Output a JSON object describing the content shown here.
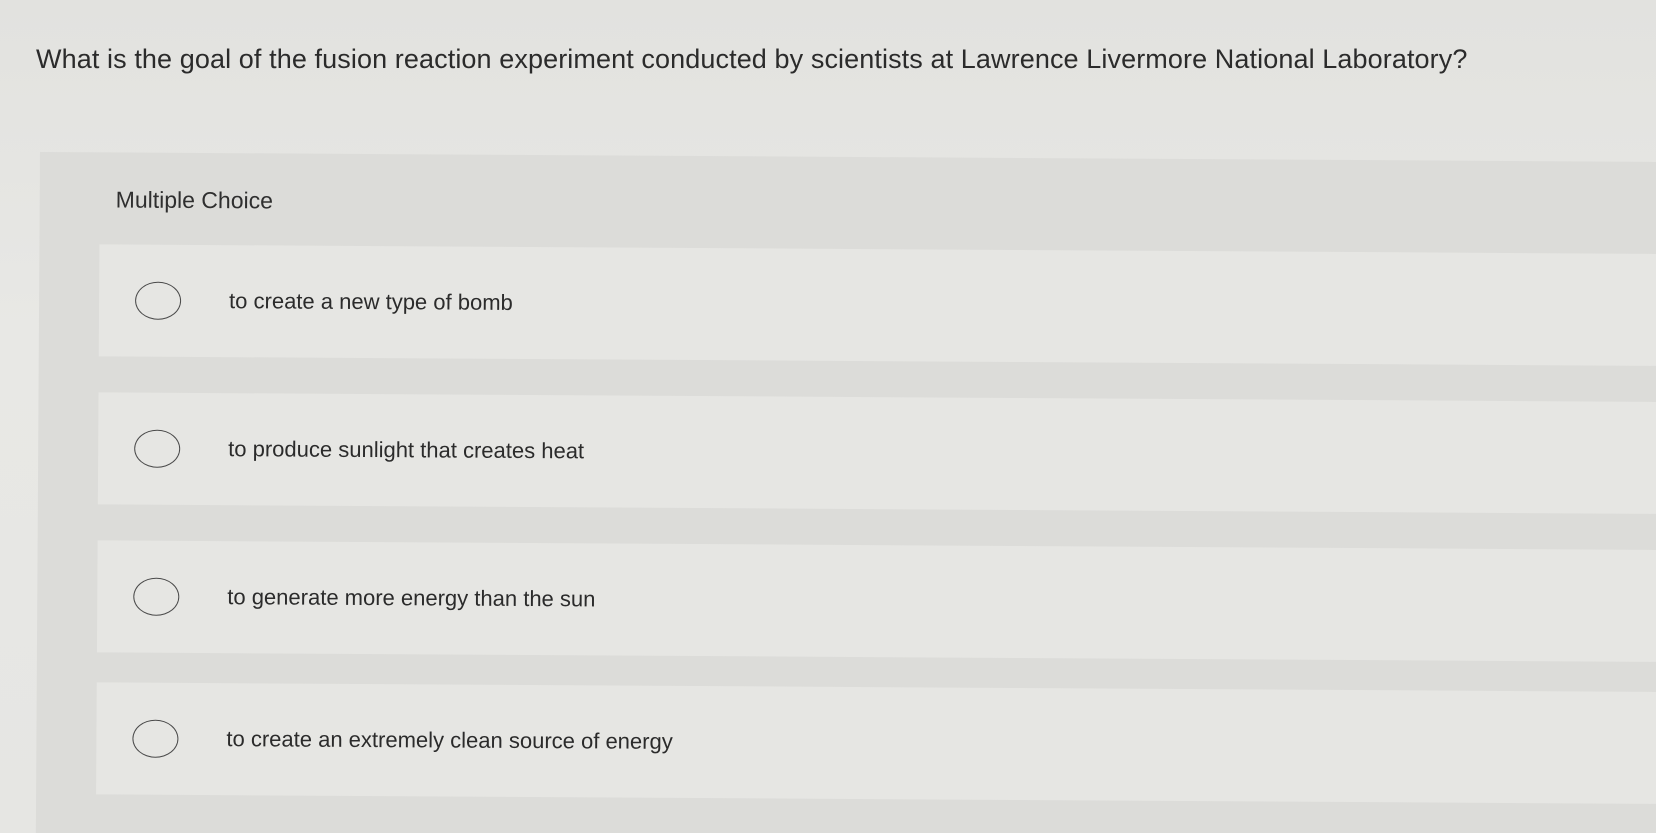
{
  "question": {
    "text": "What is the goal of the fusion reaction experiment conducted by scientists at Lawrence Livermore National Laboratory?"
  },
  "multiple_choice": {
    "label": "Multiple Choice",
    "options": [
      {
        "label": "to create a new type of bomb",
        "selected": false
      },
      {
        "label": "to produce sunlight that creates heat",
        "selected": false
      },
      {
        "label": "to generate more energy than the sun",
        "selected": false
      },
      {
        "label": "to create an extremely clean source of energy",
        "selected": false
      }
    ]
  },
  "colors": {
    "text": "#2b2b2b",
    "panel": "#dcdcd9",
    "option_bg": "#e6e6e3",
    "radio_border": "#4a4a4a"
  }
}
